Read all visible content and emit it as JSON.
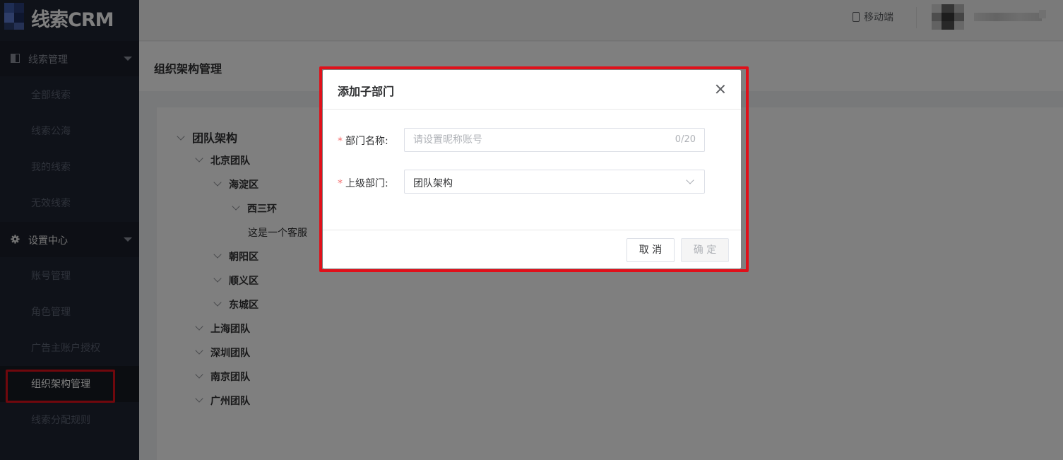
{
  "brand": {
    "logo_text": "线索CRM"
  },
  "sidebar": {
    "groups": [
      {
        "label": "线索管理",
        "icon": "book-icon",
        "items": [
          "全部线索",
          "线索公海",
          "我的线索",
          "无效线索"
        ]
      },
      {
        "label": "设置中心",
        "icon": "gear-icon",
        "items": [
          "账号管理",
          "角色管理",
          "广告主账户授权",
          "组织架构管理",
          "线索分配规则"
        ]
      }
    ],
    "active_item": "组织架构管理"
  },
  "header": {
    "mobile_label": "移动端"
  },
  "page": {
    "title": "组织架构管理"
  },
  "tree": {
    "root": "团队架构",
    "nodes": {
      "beijing": "北京团队",
      "haidian": "海淀区",
      "xisanhuan": "西三环",
      "kefu": "这是一个客服",
      "chaoyang": "朝阳区",
      "shunyi": "顺义区",
      "dongcheng": "东城区",
      "shanghai": "上海团队",
      "shenzhen": "深圳团队",
      "nanjing": "南京团队",
      "guangzhou": "广州团队"
    }
  },
  "dialog": {
    "title": "添加子部门",
    "name_label": "部门名称:",
    "name_placeholder": "请设置昵称账号",
    "name_value": "",
    "name_counter": "0/20",
    "parent_label": "上级部门:",
    "parent_value": "团队架构",
    "required_mark": "*",
    "cancel_label": "取 消",
    "ok_label": "确 定"
  },
  "colors": {
    "sidebar_bg": "#1f2433",
    "highlight": "#e0101a",
    "required": "#f56c6c"
  }
}
